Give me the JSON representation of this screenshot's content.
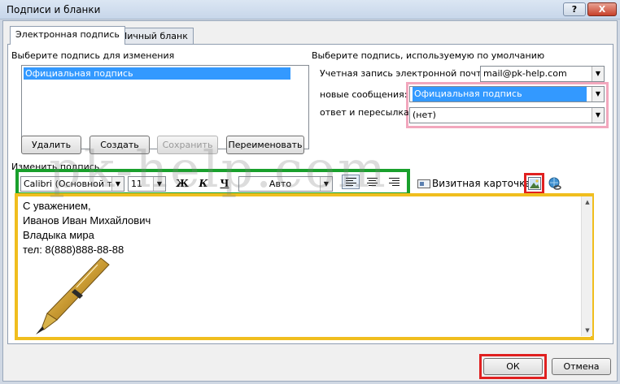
{
  "window": {
    "title": "Подписи и бланки",
    "help": "?",
    "close": "X"
  },
  "tabs": [
    "Электронная подпись",
    "Личный бланк"
  ],
  "left": {
    "heading": "Выберите подпись для изменения",
    "items": [
      "Официальная подпись"
    ],
    "buttons": {
      "delete": "Удалить",
      "create": "Создать",
      "save": "Сохранить",
      "rename": "Переименовать"
    }
  },
  "right": {
    "heading": "Выберите подпись, используемую по умолчанию",
    "account_label": "Учетная запись электронной почты:",
    "account_value": "mail@pk-help.com",
    "new_label": "новые сообщения:",
    "new_value": "Официальная подпись",
    "reply_label": "ответ и пересылка:",
    "reply_value": "(нет)"
  },
  "editor": {
    "heading": "Изменить подпись",
    "font": "Calibri (Основной текс",
    "size": "11",
    "bold": "Ж",
    "italic": "К",
    "underline": "Ч",
    "color": "Авто",
    "business_card": "Визитная карточка",
    "lines": [
      "С уважением,",
      "Иванов Иван Михайлович",
      "Владыка мира",
      "тел: 8(888)888-88-88"
    ],
    "watermark": "pk-help.com"
  },
  "footer": {
    "ok": "ОК",
    "cancel": "Отмена"
  },
  "colors": {
    "green_box": "#19a02c",
    "red_box": "#e02020",
    "yellow_box": "#f0be1e",
    "pink_box": "#f2a7bd",
    "selection": "#3399ff"
  },
  "icons": [
    "insert-picture-icon",
    "hyperlink-icon",
    "business-card-icon",
    "pen-image"
  ]
}
